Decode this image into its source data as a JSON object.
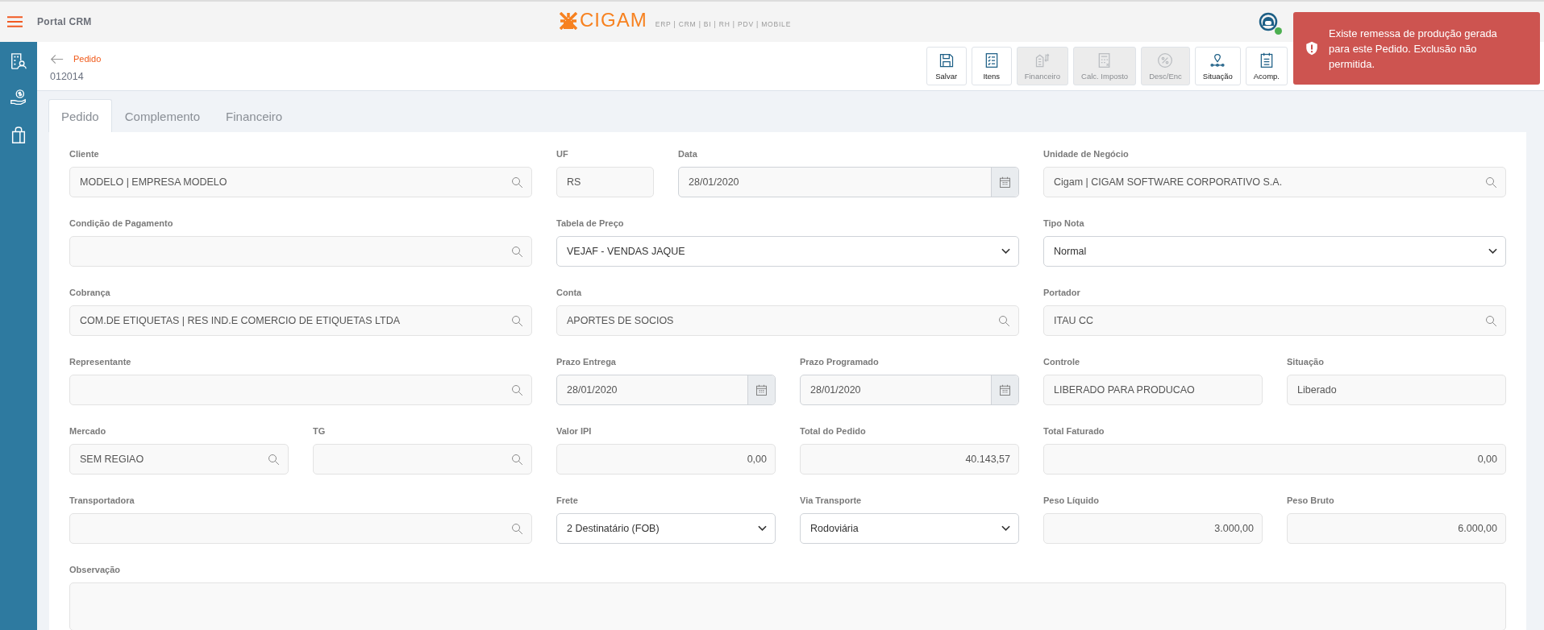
{
  "header": {
    "app_title": "Portal CRM",
    "logo": {
      "brand": "CIGAM",
      "tagline": "ERP | CRM | BI | RH | PDV | MOBILE"
    },
    "online": true
  },
  "page": {
    "title": "Pedido",
    "number": "012014"
  },
  "toolbar": [
    {
      "label": "Salvar",
      "disabled": false
    },
    {
      "label": "Itens",
      "disabled": false
    },
    {
      "label": "Financeiro",
      "disabled": true
    },
    {
      "label": "Calc. Imposto",
      "disabled": true
    },
    {
      "label": "Desc/Enc",
      "disabled": true
    },
    {
      "label": "Situação",
      "disabled": false
    },
    {
      "label": "Acomp.",
      "disabled": false
    }
  ],
  "toast": {
    "kind": "error",
    "message": "Existe remessa de produção gerada para este Pedido. Exclusão não permitida."
  },
  "tabs": [
    {
      "label": "Pedido",
      "selected": true
    },
    {
      "label": "Complemento",
      "selected": false
    },
    {
      "label": "Financeiro",
      "selected": false
    }
  ],
  "form_rows": [
    [
      {
        "label": "Cliente",
        "kind": "search",
        "value": "MODELO | EMPRESA MODELO"
      },
      {
        "label": "UF",
        "kind": "text",
        "value": "RS"
      },
      {
        "label": "Data",
        "kind": "date",
        "value": "28/01/2020"
      },
      {
        "label": "Unidade de Negócio",
        "kind": "search",
        "value": "Cigam | CIGAM SOFTWARE CORPORATIVO S.A."
      }
    ],
    [
      {
        "label": "Condição de Pagamento",
        "kind": "search"
      },
      {
        "label": "Tabela de Preço",
        "kind": "select",
        "value": "VEJAF - VENDAS JAQUE"
      },
      {
        "label": "Tipo Nota",
        "kind": "select",
        "value": "Normal"
      }
    ],
    [
      {
        "label": "Cobrança",
        "kind": "search",
        "value": "COM.DE ETIQUETAS | RES IND.E COMERCIO DE ETIQUETAS LTDA"
      },
      {
        "label": "Conta",
        "kind": "search",
        "value": "APORTES DE SOCIOS"
      },
      {
        "label": "Portador",
        "kind": "search",
        "value": "ITAU CC"
      }
    ],
    [
      {
        "label": "Representante",
        "kind": "search"
      },
      {
        "label": "Prazo Entrega",
        "kind": "date",
        "value": "28/01/2020"
      },
      {
        "label": "Prazo Programado",
        "kind": "date",
        "value": "28/01/2020"
      },
      {
        "label": "Controle",
        "kind": "text",
        "value": "LIBERADO PARA PRODUCAO"
      },
      {
        "label": "Situação",
        "kind": "text",
        "value": "Liberado"
      }
    ],
    [
      {
        "label": "Mercado",
        "kind": "search",
        "value": "SEM REGIAO"
      },
      {
        "label": "TG",
        "kind": "search"
      },
      {
        "label": "Valor IPI",
        "kind": "number",
        "value": "0,00"
      },
      {
        "label": "Total do Pedido",
        "kind": "number",
        "value": "40.143,57"
      },
      {
        "label": "Total Faturado",
        "kind": "number",
        "value": "0,00"
      }
    ],
    [
      {
        "label": "Transportadora",
        "kind": "search"
      },
      {
        "label": "Frete",
        "kind": "select",
        "value": "2 Destinatário (FOB)"
      },
      {
        "label": "Via Transporte",
        "kind": "select",
        "value": "Rodoviária"
      },
      {
        "label": "Peso Líquido",
        "kind": "number",
        "value": "3.000,00"
      },
      {
        "label": "Peso Bruto",
        "kind": "number",
        "value": "6.000,00"
      }
    ],
    [
      {
        "label": "Observação",
        "kind": "textarea"
      }
    ]
  ]
}
